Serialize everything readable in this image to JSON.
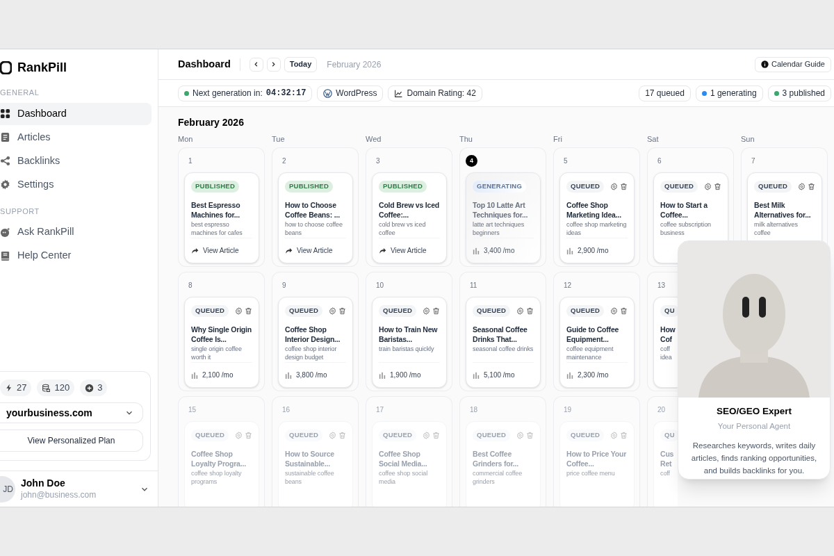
{
  "app": {
    "logo": "RankPill"
  },
  "sidebar": {
    "sections": [
      {
        "heading": "GENERAL",
        "items": [
          {
            "label": "Dashboard",
            "kind": "grid",
            "selected": true
          },
          {
            "label": "Articles",
            "kind": "doc",
            "selected": false
          },
          {
            "label": "Backlinks",
            "kind": "share",
            "selected": false
          },
          {
            "label": "Settings",
            "kind": "gear",
            "selected": false
          }
        ]
      },
      {
        "heading": "SUPPORT",
        "items": [
          {
            "label": "Ask RankPill",
            "kind": "chat",
            "selected": false
          },
          {
            "label": "Help Center",
            "kind": "book",
            "selected": false
          }
        ]
      }
    ],
    "credits": [
      {
        "kind": "bolt",
        "value": "27"
      },
      {
        "kind": "coins",
        "value": "120"
      },
      {
        "kind": "plus",
        "value": "3"
      }
    ],
    "site_select": {
      "value": "yourbusiness.com"
    },
    "plan_button": "View Personalized Plan",
    "user": {
      "initials": "JD",
      "name": "John Doe",
      "email": "john@business.com"
    }
  },
  "header": {
    "title": "Dashboard",
    "today_button": "Today",
    "month": "February 2026",
    "guide_button": "Calendar Guide"
  },
  "status_bar": {
    "left": [
      {
        "kind": "timer",
        "label": "Next generation in:",
        "value": "04:32:17",
        "color": "#3aa76d"
      },
      {
        "kind": "wordpress",
        "label": "WordPress"
      },
      {
        "kind": "rating",
        "label": "Domain Rating: 42"
      }
    ],
    "right": [
      {
        "label": "17 queued"
      },
      {
        "label": "1 generating",
        "color": "#2b8cf0"
      },
      {
        "label": "3 published",
        "color": "#3aa76d"
      }
    ]
  },
  "calendar": {
    "title": "February 2026",
    "weekdays": [
      "Mon",
      "Tue",
      "Wed",
      "Thu",
      "Fri",
      "Sat",
      "Sun"
    ],
    "weeks": [
      {
        "faded": false,
        "days": [
          {
            "day": "1",
            "today": false,
            "article": {
              "kind": "published",
              "badge": "PUBLISHED",
              "title": "Best Espresso Machines for...",
              "keyword": "best espresso machines for cafes",
              "action": "View Article"
            }
          },
          {
            "day": "2",
            "today": false,
            "article": {
              "kind": "published",
              "badge": "PUBLISHED",
              "title": "How to Choose Coffee Beans: ...",
              "keyword": "how to choose coffee beans",
              "action": "View Article"
            }
          },
          {
            "day": "3",
            "today": false,
            "article": {
              "kind": "published",
              "badge": "PUBLISHED",
              "title": "Cold Brew vs Iced Coffee:...",
              "keyword": "cold brew vs iced coffee",
              "action": "View Article"
            }
          },
          {
            "day": "4",
            "today": true,
            "article": {
              "kind": "generating",
              "badge": "GENERATING",
              "title": "Top 10 Latte Art Techniques for...",
              "keyword": "latte art techniques beginners",
              "metric": "3,400 /mo"
            }
          },
          {
            "day": "5",
            "today": false,
            "article": {
              "kind": "queued",
              "badge": "QUEUED",
              "title": "Coffee Shop Marketing Idea...",
              "keyword": "coffee shop marketing ideas",
              "metric": "2,900 /mo"
            }
          },
          {
            "day": "6",
            "today": false,
            "article": {
              "kind": "queued",
              "badge": "QUEUED",
              "title": "How to Start a Coffee...",
              "keyword": "coffee subscription business"
            }
          },
          {
            "day": "7",
            "today": false,
            "article": {
              "kind": "queued",
              "badge": "QUEUED",
              "title": "Best Milk Alternatives for...",
              "keyword": "milk alternatives coffee"
            }
          }
        ]
      },
      {
        "faded": false,
        "days": [
          {
            "day": "8",
            "today": false,
            "article": {
              "kind": "queued",
              "badge": "QUEUED",
              "title": "Why Single Origin Coffee Is...",
              "keyword": "single origin coffee worth it",
              "metric": "2,100 /mo"
            }
          },
          {
            "day": "9",
            "today": false,
            "article": {
              "kind": "queued",
              "badge": "QUEUED",
              "title": "Coffee Shop Interior Design...",
              "keyword": "coffee shop interior design budget",
              "metric": "3,800 /mo"
            }
          },
          {
            "day": "10",
            "today": false,
            "article": {
              "kind": "queued",
              "badge": "QUEUED",
              "title": "How to Train New Baristas...",
              "keyword": "train baristas quickly",
              "metric": "1,900 /mo"
            }
          },
          {
            "day": "11",
            "today": false,
            "article": {
              "kind": "queued",
              "badge": "QUEUED",
              "title": "Seasonal Coffee Drinks That...",
              "keyword": "seasonal coffee drinks",
              "metric": "5,100 /mo"
            }
          },
          {
            "day": "12",
            "today": false,
            "article": {
              "kind": "queued",
              "badge": "QUEUED",
              "title": "Guide to Coffee Equipment...",
              "keyword": "coffee equipment maintenance",
              "metric": "2,300 /mo"
            }
          },
          {
            "day": "13",
            "today": false,
            "partial": true,
            "article": {
              "kind": "queued",
              "badge": "QU",
              "title": "How Cof",
              "keyword": "coff idea"
            }
          }
        ]
      },
      {
        "faded": true,
        "days": [
          {
            "day": "15",
            "today": false,
            "article": {
              "kind": "queued",
              "badge": "QUEUED",
              "title": "Coffee Shop Loyalty Progra...",
              "keyword": "coffee shop loyalty programs"
            }
          },
          {
            "day": "16",
            "today": false,
            "article": {
              "kind": "queued",
              "badge": "QUEUED",
              "title": "How to Source Sustainable...",
              "keyword": "sustainable coffee beans"
            }
          },
          {
            "day": "17",
            "today": false,
            "article": {
              "kind": "queued",
              "badge": "QUEUED",
              "title": "Coffee Shop Social Media...",
              "keyword": "coffee shop social media"
            }
          },
          {
            "day": "18",
            "today": false,
            "article": {
              "kind": "queued",
              "badge": "QUEUED",
              "title": "Best Coffee Grinders for...",
              "keyword": "commercial coffee grinders"
            }
          },
          {
            "day": "19",
            "today": false,
            "article": {
              "kind": "queued",
              "badge": "QUEUED",
              "title": "How to Price Your Coffee...",
              "keyword": "price coffee menu"
            }
          },
          {
            "day": "20",
            "today": false,
            "partial": true,
            "article": {
              "kind": "queued",
              "badge": "QU",
              "title": "Cus Ret",
              "keyword": "coff"
            }
          }
        ]
      }
    ]
  },
  "agent_card": {
    "title": "SEO/GEO Expert",
    "subtitle": "Your Personal Agent",
    "description": "Researches keywords, writes daily articles, finds ranking opportunities, and builds backlinks for you."
  }
}
